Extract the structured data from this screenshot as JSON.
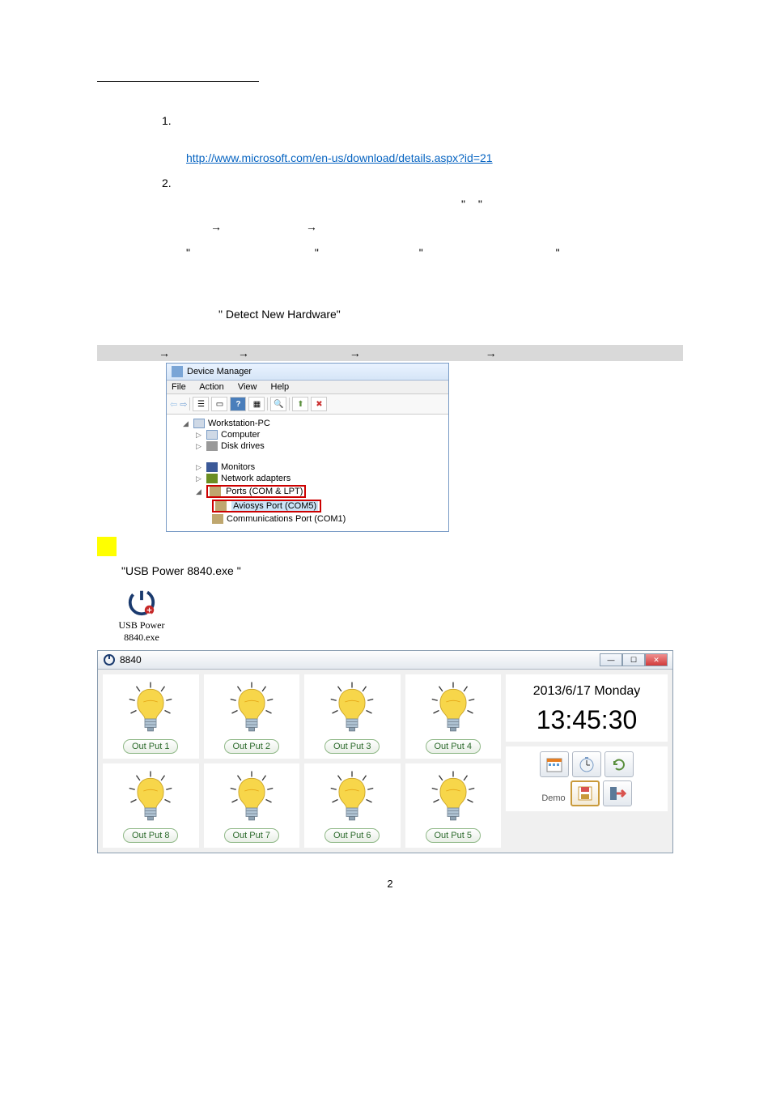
{
  "ms_link": "http://www.microsoft.com/en-us/download/details.aspx?id=21",
  "detect_hw": "\" Detect New Hardware\"",
  "exe_label": "\"USB Power 8840.exe \"",
  "usb_icon_label": "USB Power\n8840.exe",
  "devmgr": {
    "title": "Device Manager",
    "menus": [
      "File",
      "Action",
      "View",
      "Help"
    ],
    "tree": {
      "root": "Workstation-PC",
      "computer": "Computer",
      "disk": "Disk drives",
      "monitors": "Monitors",
      "network": "Network adapters",
      "ports": "Ports (COM & LPT)",
      "aviosys": "Aviosys Port (COM5)",
      "comm": "Communications Port (COM1)"
    }
  },
  "app": {
    "title": "8840",
    "date": "2013/6/17   Monday",
    "time": "13:45:30",
    "outputs_row1": [
      "Out Put 1",
      "Out Put 2",
      "Out Put 3",
      "Out Put 4"
    ],
    "outputs_row2": [
      "Out Put 8",
      "Out Put 7",
      "Out Put 6",
      "Out Put 5"
    ],
    "demo": "Demo"
  },
  "arrows": {
    "a": "→"
  },
  "page_num": "2"
}
